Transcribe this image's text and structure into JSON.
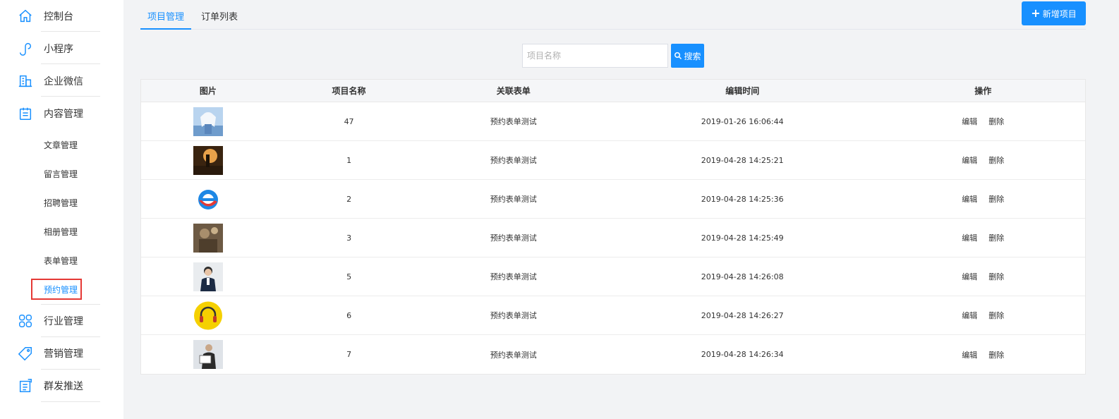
{
  "sidebar": {
    "items": [
      {
        "label": "控制台",
        "icon": "home-icon"
      },
      {
        "label": "小程序",
        "icon": "mini-program-icon"
      },
      {
        "label": "企业微信",
        "icon": "building-icon"
      },
      {
        "label": "内容管理",
        "icon": "clipboard-icon"
      },
      {
        "label": "行业管理",
        "icon": "grid-icon"
      },
      {
        "label": "营销管理",
        "icon": "tag-icon"
      },
      {
        "label": "群发推送",
        "icon": "broadcast-icon"
      }
    ],
    "subitems": [
      {
        "label": "文章管理"
      },
      {
        "label": "留言管理"
      },
      {
        "label": "招聘管理"
      },
      {
        "label": "相册管理"
      },
      {
        "label": "表单管理"
      },
      {
        "label": "预约管理",
        "active": true
      }
    ]
  },
  "tabs": [
    {
      "label": "项目管理",
      "active": true
    },
    {
      "label": "订单列表",
      "active": false
    }
  ],
  "add_button": {
    "label": "新增项目"
  },
  "search": {
    "placeholder": "项目名称",
    "button_label": "搜索"
  },
  "table": {
    "headers": [
      "图片",
      "项目名称",
      "关联表单",
      "编辑时间",
      "操作"
    ],
    "rows": [
      {
        "name": "47",
        "form": "预约表单测试",
        "time": "2019-01-26 16:06:44",
        "edit": "编辑",
        "delete": "删除",
        "thumb": "anime-figure"
      },
      {
        "name": "1",
        "form": "预约表单测试",
        "time": "2019-04-28 14:25:21",
        "edit": "编辑",
        "delete": "删除",
        "thumb": "sunset-figure"
      },
      {
        "name": "2",
        "form": "预约表单测试",
        "time": "2019-04-28 14:25:36",
        "edit": "编辑",
        "delete": "删除",
        "thumb": "ie-logo"
      },
      {
        "name": "3",
        "form": "预约表单测试",
        "time": "2019-04-28 14:25:49",
        "edit": "编辑",
        "delete": "删除",
        "thumb": "blurred-photo"
      },
      {
        "name": "5",
        "form": "预约表单测试",
        "time": "2019-04-28 14:26:08",
        "edit": "编辑",
        "delete": "删除",
        "thumb": "person-suit"
      },
      {
        "name": "6",
        "form": "预约表单测试",
        "time": "2019-04-28 14:26:27",
        "edit": "编辑",
        "delete": "删除",
        "thumb": "yellow-headphones"
      },
      {
        "name": "7",
        "form": "预约表单测试",
        "time": "2019-04-28 14:26:34",
        "edit": "编辑",
        "delete": "删除",
        "thumb": "person-sign"
      }
    ]
  },
  "colors": {
    "accent": "#1890ff",
    "active_outline": "#e53935"
  }
}
